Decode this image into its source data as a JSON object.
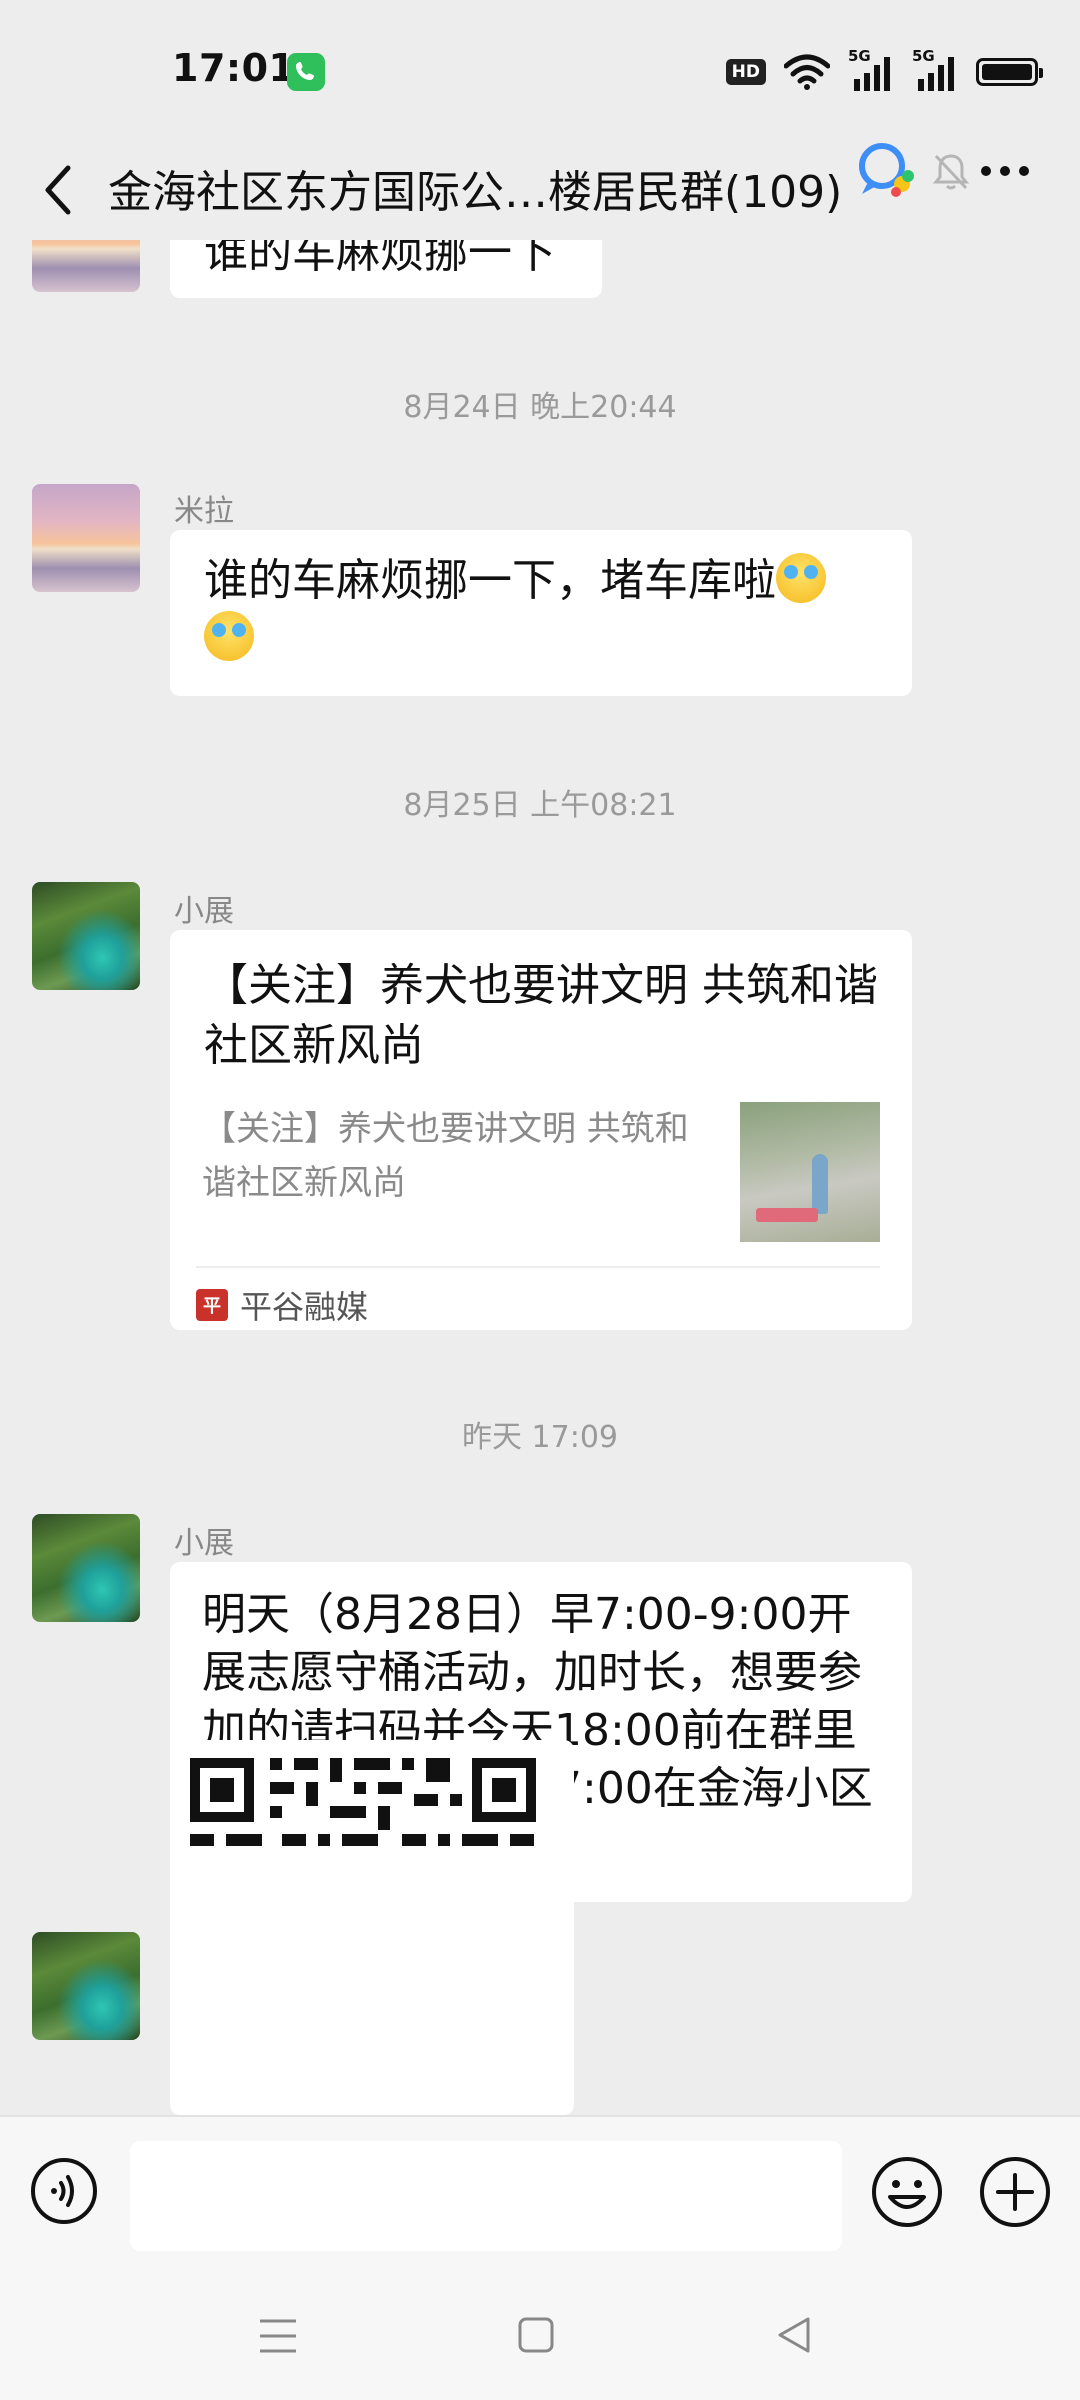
{
  "status_bar": {
    "time": "17:01",
    "hd_label": "HD",
    "sim1_label": "5G",
    "sim2_label": "5G",
    "icons": [
      "phone-icon",
      "hd-icon",
      "wifi-icon",
      "signal-icon",
      "signal-icon",
      "battery-icon"
    ]
  },
  "header": {
    "title": "金海社区东方国际公…楼居民群(109)",
    "icons": [
      "back-icon",
      "search-chat-icon",
      "mute-icon",
      "more-icon"
    ]
  },
  "messages": {
    "partial_text": "谁的车麻烦挪一下",
    "ts1": "8月24日 晚上20:44",
    "m1_sender": "米拉",
    "m1_text": "谁的车麻烦挪一下，堵车库啦",
    "ts2": "8月25日 上午08:21",
    "m2_sender": "小展",
    "m2_article_title": "【关注】养犬也要讲文明 共筑和谐社区新风尚",
    "m2_article_desc": "【关注】养犬也要讲文明 共筑和谐社区新风尚",
    "m2_source_logo": "平",
    "m2_source": "平谷融媒",
    "ts3": "昨天 17:09",
    "m3_sender": "小展",
    "m3_text": "明天（8月28日）早7:00-9:00开展志愿守桶活动，加时长，想要参加的请扫码并今天18:00前在群里报名，并于明天早7:00在金海小区7号楼东房山集合",
    "m4_sender": "小展"
  },
  "input_bar": {
    "placeholder": "",
    "icons": [
      "voice-icon",
      "emoji-icon",
      "plus-icon"
    ]
  },
  "nav_bar": {
    "icons": [
      "menu-icon",
      "home-icon",
      "back-triangle-icon"
    ]
  }
}
